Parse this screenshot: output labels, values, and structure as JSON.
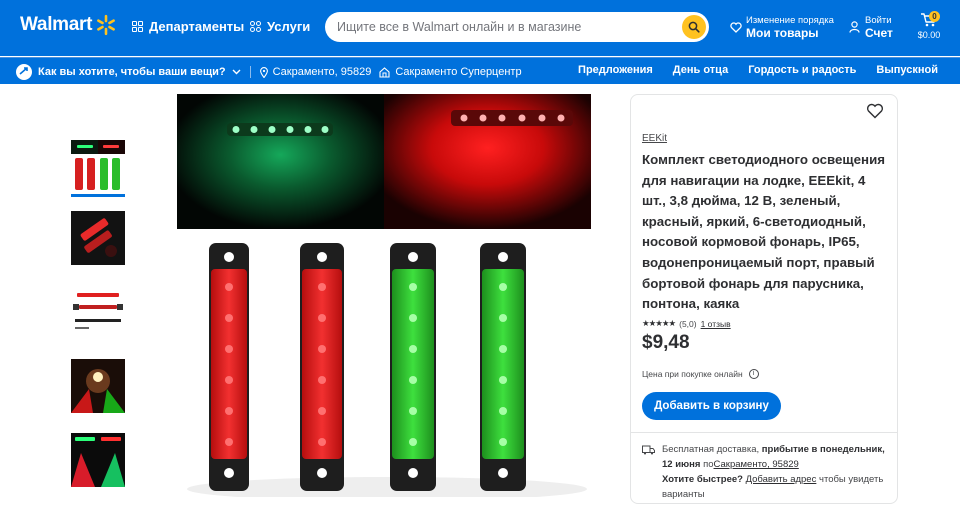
{
  "header": {
    "logo_text": "Walmart",
    "departments_label": "Департаменты",
    "services_label": "Услуги",
    "search_placeholder": "Ищите все в Walmart онлайн и в магазине",
    "reorder_small": "Изменение порядка",
    "reorder_big": "Мои товары",
    "signin_small": "Войти",
    "signin_big": "Счет",
    "cart_count": "0",
    "cart_total": "$0.00",
    "brand_color": "#0071dc",
    "accent_color": "#ffc220"
  },
  "subheader": {
    "delivery_prompt": "Как вы хотите, чтобы ваши вещи?",
    "location": "Сакраменто, 95829",
    "store": "Сакраменто Суперцентр",
    "links": [
      "Предложения",
      "День отца",
      "Гордость и радость",
      "Выпускной"
    ]
  },
  "product": {
    "brand": "EEKit",
    "title": "Комплект светодиодного освещения для навигации на лодке, EEEkit, 4 шт., 3,8 дюйма, 12 В, зеленый, красный, яркий, 6-светодиодный, носовой кормовой фонарь, IP65, водонепроницаемый порт, правый бортовой фонарь для парусника, понтона, каяка",
    "stars": "★★★★★",
    "rating_value": "(5,0)",
    "review_count": "1 отзыв",
    "price": "$9,48",
    "price_label": "Цена при покупке онлайн",
    "add_to_cart": "Добавить в корзину",
    "shipping_prefix": "Бесплатная доставка,",
    "shipping_arrival": "прибытие в понедельник, 12 июня",
    "shipping_to": "по",
    "shipping_location": "Сакраменто, 95829",
    "faster_prefix": "Хотите быстрее?",
    "faster_link": "Добавить адрес",
    "faster_suffix": "чтобы увидеть варианты"
  },
  "icons": [
    "spark-logo-icon",
    "grid-icon",
    "search-icon",
    "heart-icon",
    "user-icon",
    "cart-icon",
    "truck-icon",
    "chevron-down-icon",
    "pin-icon",
    "store-icon",
    "info-icon"
  ]
}
